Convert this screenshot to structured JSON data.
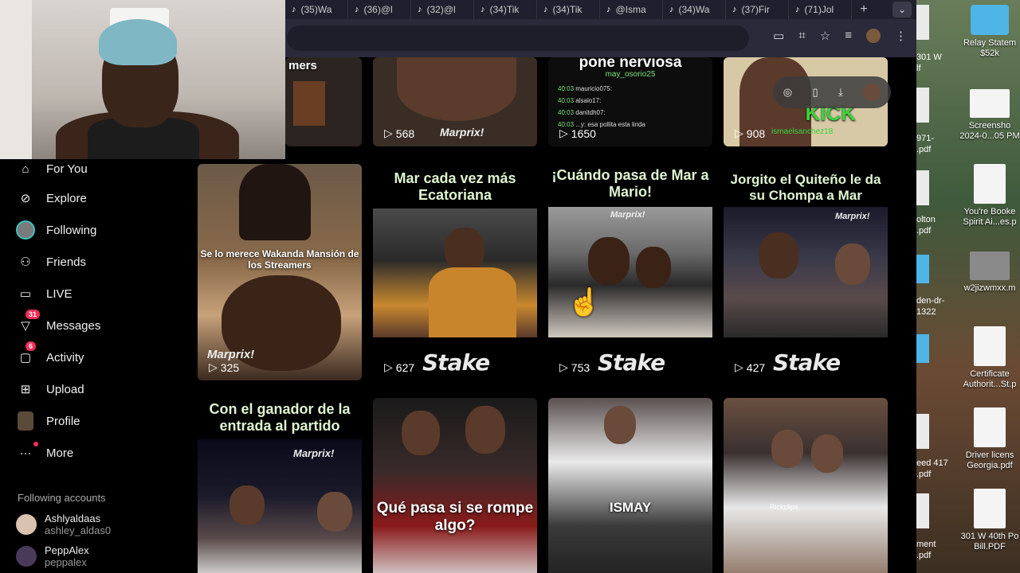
{
  "browser": {
    "tabs": [
      "(35)Wa",
      "(36)@l",
      "(32)@l",
      "(34)Tik",
      "(34)Tik",
      "@Isma",
      "(34)Wa",
      "(37)Fir",
      "(71)Jol"
    ],
    "new_tab": "+",
    "tab_menu": "⌄"
  },
  "sidebar": {
    "items": [
      {
        "label": "For You",
        "icon": "home-icon"
      },
      {
        "label": "Explore",
        "icon": "compass-icon"
      },
      {
        "label": "Following",
        "icon": "following-avatar-icon"
      },
      {
        "label": "Friends",
        "icon": "friends-icon"
      },
      {
        "label": "LIVE",
        "icon": "live-icon"
      },
      {
        "label": "Messages",
        "icon": "messages-icon",
        "badge": "31"
      },
      {
        "label": "Activity",
        "icon": "activity-icon",
        "badge": "6"
      },
      {
        "label": "Upload",
        "icon": "upload-icon"
      },
      {
        "label": "Profile",
        "icon": "profile-avatar-icon"
      },
      {
        "label": "More",
        "icon": "more-icon"
      }
    ],
    "following_title": "Following accounts",
    "accounts": [
      {
        "name": "Ashlyaldaas",
        "username": "ashley_aldas0"
      },
      {
        "name": "PeppAlex",
        "username": "peppalex"
      }
    ]
  },
  "videos": {
    "row0": [
      {
        "caption": "mers",
        "views": ""
      },
      {
        "caption": "",
        "views": "568"
      },
      {
        "caption": "pone nerviosa",
        "sub": "may_osorio25",
        "views": "1650",
        "chat": [
          "mauricio075:",
          "alsalo17:",
          "danitdh07:",
          "...y: esa pollita esta linda"
        ]
      },
      {
        "caption": "KICK",
        "sub": "ismaelsanchez18",
        "views": "908"
      }
    ],
    "row1": [
      {
        "caption": "Se lo merece Wakanda Mansión de los Streamers",
        "views": "325",
        "watermark": "Marprix!"
      },
      {
        "caption": "Mar cada vez más Ecatoriana",
        "views": "627",
        "brand": "Stake"
      },
      {
        "caption": "¡Cuándo pasa de Mar a Mario!",
        "views": "753",
        "brand": "Stake",
        "watermark": "Marprix!"
      },
      {
        "caption": "Jorgito el Quiteño le da su Chompa a Mar",
        "views": "427",
        "brand": "Stake",
        "watermark": "Marprix!"
      }
    ],
    "row2": [
      {
        "caption": "Con el ganador de la entrada al partido",
        "watermark": "Marprix!"
      },
      {
        "caption": "Qué pasa si se rompe algo?"
      },
      {
        "caption": "ISMAY"
      },
      {
        "caption": "Rickclips"
      }
    ]
  },
  "desktop": {
    "items": [
      {
        "label": "Relay Statem $52k"
      },
      {
        "label": "Screensho 2024-0...05 PM"
      },
      {
        "label": "You're Booke Spirit Ai...es.p"
      },
      {
        "label": "w2jizwmxx.m"
      },
      {
        "label": "Certificate Authorit...St.p"
      },
      {
        "label": "Driver licens Georgia.pdf"
      },
      {
        "label": "301 W 40th Po Bill.PDF"
      }
    ],
    "left_edge": [
      "301 W",
      "lf",
      "971-",
      ".pdf",
      "olton",
      ".pdf",
      "den-dr-",
      "1322",
      "eed 417",
      ".pdf",
      "ment",
      ".pdf"
    ]
  }
}
